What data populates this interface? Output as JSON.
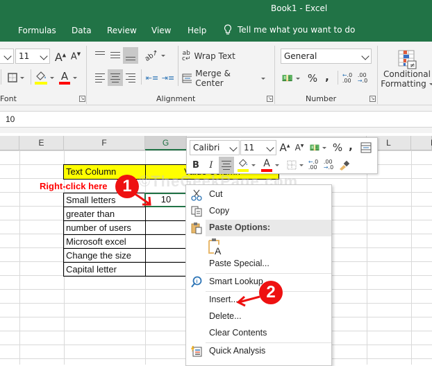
{
  "window": {
    "title": "Book1  -  Excel"
  },
  "ribbon_tabs": [
    "Formulas",
    "Data",
    "Review",
    "View",
    "Help"
  ],
  "tell_me": "Tell me what you want to do",
  "ribbon": {
    "font_size": "11",
    "groups": {
      "font": "Font",
      "alignment": "Alignment",
      "number": "Number"
    },
    "wrap_text": "Wrap Text",
    "merge_center": "Merge & Center",
    "number_format": "General",
    "percent": "%",
    "comma": ",",
    "conditional_formatting_line1": "Conditional",
    "conditional_formatting_line2": "Formatting",
    "colors": {
      "fill": "#ffff00",
      "font": "#ff0000",
      "brand": "#217346"
    }
  },
  "formula_bar": {
    "value": "10"
  },
  "columns": [
    "E",
    "F",
    "G",
    "L",
    "M"
  ],
  "selected_column": "G",
  "sheet": {
    "header": {
      "text_column": "Text Column",
      "value_column": "Value Column"
    },
    "rows": [
      {
        "text": "Small letters",
        "value": "10"
      },
      {
        "text": "greater than",
        "value": ""
      },
      {
        "text": "number of users",
        "value": ""
      },
      {
        "text": "Microsoft excel",
        "value": ""
      },
      {
        "text": "Change the size",
        "value": ""
      },
      {
        "text": "Capital letter",
        "value": ""
      }
    ]
  },
  "annotations": {
    "instruction": "Right-click here",
    "step1": "1",
    "step2": "2",
    "watermark": "©TheGeekPage.com"
  },
  "mini_toolbar": {
    "font_name": "Calibri",
    "font_size": "11",
    "bold": "B",
    "italic": "I",
    "percent": "%",
    "comma": ","
  },
  "context_menu": {
    "items": [
      {
        "label": "Cut",
        "icon": "scissors-icon"
      },
      {
        "label": "Copy",
        "icon": "copy-icon"
      },
      {
        "label": "Paste Options:",
        "icon": "paste-icon",
        "header": true
      },
      {
        "label": "Paste Special...",
        "icon": ""
      },
      {
        "label": "Smart Lookup",
        "icon": "smart-lookup-icon"
      },
      {
        "label": "Insert...",
        "icon": ""
      },
      {
        "label": "Delete...",
        "icon": ""
      },
      {
        "label": "Clear Contents",
        "icon": ""
      },
      {
        "label": "Quick Analysis",
        "icon": "quick-analysis-icon"
      }
    ]
  }
}
